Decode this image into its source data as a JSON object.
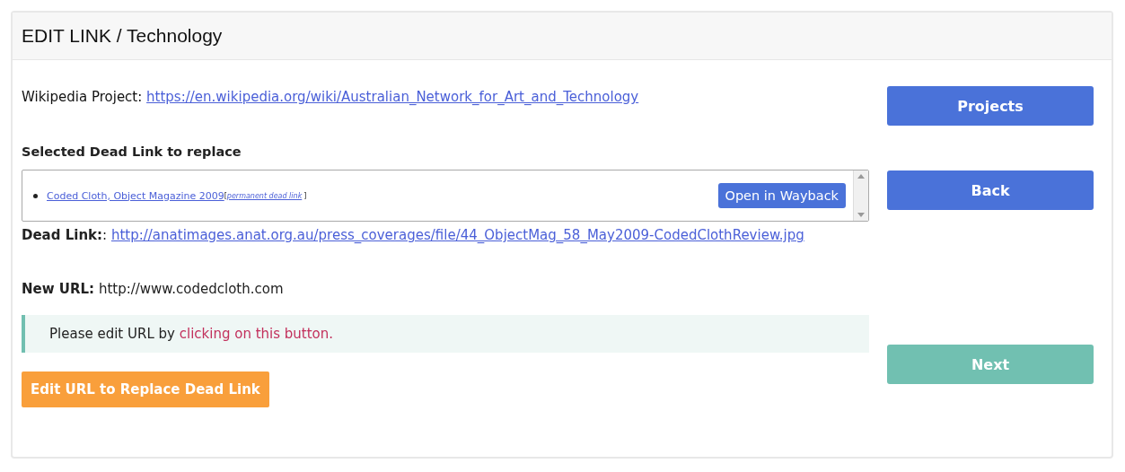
{
  "header": {
    "title": "EDIT LINK / Technology"
  },
  "project": {
    "label": "Wikipedia Project:",
    "url": "https://en.wikipedia.org/wiki/Australian_Network_for_Art_and_Technology"
  },
  "selected_heading": "Selected Dead Link to replace",
  "dead_link_list": {
    "items": [
      {
        "label": "Coded Cloth, Object Magazine 2009",
        "note_open": "[",
        "note": "permanent dead link",
        "note_close": "]",
        "action": "Open in Wayback"
      }
    ]
  },
  "dead_link": {
    "label": "Dead Link:",
    "separator": ":",
    "url": "http://anatimages.anat.org.au/press_coverages/file/44_ObjectMag_58_May2009-CodedClothReview.jpg"
  },
  "new_url": {
    "label": "New URL:",
    "value": "http://www.codedcloth.com"
  },
  "hint": {
    "text": "Please edit URL by ",
    "link": "clicking on this button."
  },
  "edit_button": "Edit URL to Replace Dead Link",
  "side_buttons": [
    {
      "label": "Projects",
      "kind": "primary"
    },
    {
      "label": "Back",
      "kind": "primary"
    },
    {
      "label": "Next",
      "kind": "success"
    }
  ]
}
